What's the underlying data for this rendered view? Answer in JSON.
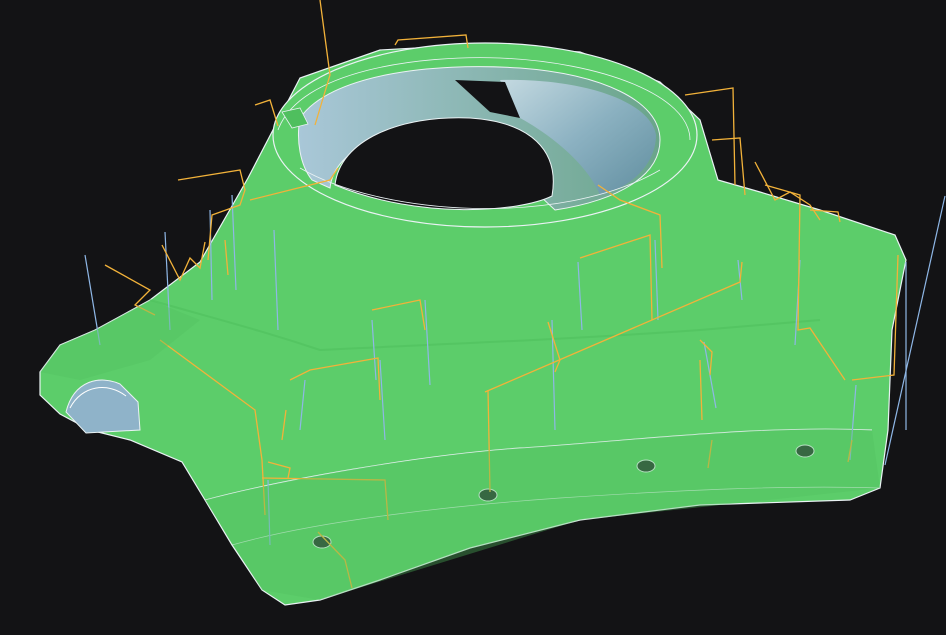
{
  "viewport": {
    "name": "3d-toolpath-viewport",
    "background": "#131315"
  },
  "part": {
    "name": "machined-housing-part",
    "surface_color": "#5ccd6a",
    "surface_shadow": "#4fbf5e",
    "bore_color": "#9cc0d6",
    "edge_color": "#eaf2f4",
    "hole_color": "#2a3a33"
  },
  "toolpaths": {
    "rapid_color": "#f2b23a",
    "plunge_color": "#8fb7e6"
  },
  "features": {
    "mounting_holes": 4,
    "bore": 1,
    "side_channel": 1
  }
}
